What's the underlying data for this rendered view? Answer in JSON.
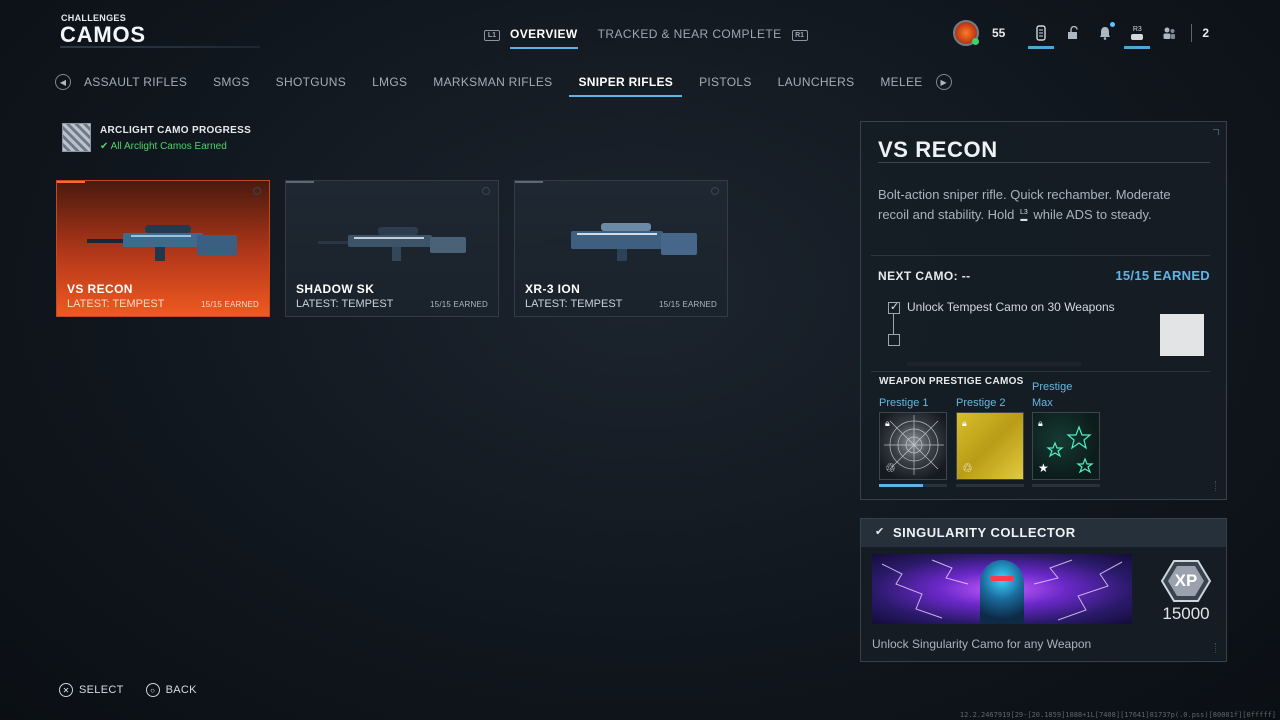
{
  "header": {
    "section": "CHALLENGES",
    "title": "CAMOS"
  },
  "topnav": {
    "left_glyph": "L1",
    "right_glyph": "R1",
    "tabs": [
      {
        "label": "OVERVIEW",
        "active": true
      },
      {
        "label": "TRACKED & NEAR COMPLETE",
        "active": false
      }
    ]
  },
  "topright": {
    "level": "55",
    "r3_glyph": "R3",
    "count": "2"
  },
  "categories": [
    {
      "label": "ASSAULT RIFLES",
      "active": false
    },
    {
      "label": "SMGS",
      "active": false
    },
    {
      "label": "SHOTGUNS",
      "active": false
    },
    {
      "label": "LMGS",
      "active": false
    },
    {
      "label": "MARKSMAN RIFLES",
      "active": false
    },
    {
      "label": "SNIPER RIFLES",
      "active": true
    },
    {
      "label": "PISTOLS",
      "active": false
    },
    {
      "label": "LAUNCHERS",
      "active": false
    },
    {
      "label": "MELEE",
      "active": false
    }
  ],
  "progress": {
    "title": "ARCLIGHT CAMO PROGRESS",
    "status": "All Arclight Camos Earned"
  },
  "weapons": [
    {
      "name": "VS RECON",
      "latest": "LATEST: TEMPEST",
      "earned": "15/15 EARNED",
      "selected": true
    },
    {
      "name": "SHADOW SK",
      "latest": "LATEST: TEMPEST",
      "earned": "15/15 EARNED",
      "selected": false
    },
    {
      "name": "XR-3 ION",
      "latest": "LATEST: TEMPEST",
      "earned": "15/15 EARNED",
      "selected": false
    }
  ],
  "detail": {
    "title": "VS RECON",
    "desc_part1": "Bolt-action sniper rifle.  Quick rechamber. Moderate recoil and stability.  Hold",
    "desc_glyph": "L3",
    "desc_part2": "while ADS to steady.",
    "next_camo": "NEXT CAMO: --",
    "earned": "15/15 EARNED",
    "challenge": "Unlock Tempest Camo on 30 Weapons",
    "prestige_title": "WEAPON PRESTIGE CAMOS",
    "prestige": [
      {
        "label": "Prestige 1",
        "progress": 0.65
      },
      {
        "label": "Prestige 2",
        "progress": 0
      },
      {
        "label": "Prestige Max",
        "progress": 0
      }
    ]
  },
  "reward": {
    "title": "SINGULARITY COLLECTOR",
    "xp_label": "XP",
    "xp": "15000",
    "desc": "Unlock Singularity Camo for any Weapon"
  },
  "footer": {
    "select_glyph": "✕",
    "select": "SELECT",
    "back_glyph": "○",
    "back": "BACK"
  },
  "build": "12.2.2467919[29-[20.1859]1088+1L[7408][17641]81737p(.0.pss)[80001f][0fffff]"
}
